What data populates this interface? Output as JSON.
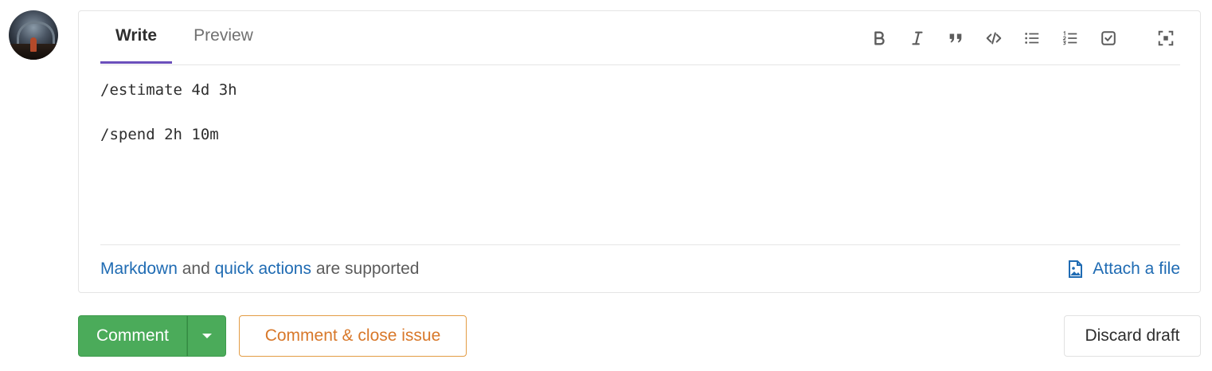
{
  "tabs": [
    {
      "label": "Write",
      "active": true
    },
    {
      "label": "Preview",
      "active": false
    }
  ],
  "toolbar": {
    "icons": [
      "bold-icon",
      "italic-icon",
      "quote-icon",
      "code-icon",
      "bullet-list-icon",
      "numbered-list-icon",
      "task-list-icon",
      "fullscreen-icon"
    ]
  },
  "editor": {
    "lines": [
      "/estimate 4d 3h",
      "/spend 2h 10m"
    ]
  },
  "footer": {
    "markdown_link": "Markdown",
    "and_text": " and ",
    "quick_actions_link": "quick actions",
    "supported_text": " are supported",
    "attach_label": "Attach a file"
  },
  "actions": {
    "comment_label": "Comment",
    "close_label": "Comment & close issue",
    "discard_label": "Discard draft"
  },
  "colors": {
    "accent": "#6b4fbb",
    "link": "#1f6bb3",
    "success": "#4bab5a",
    "warning": "#d8782a"
  }
}
